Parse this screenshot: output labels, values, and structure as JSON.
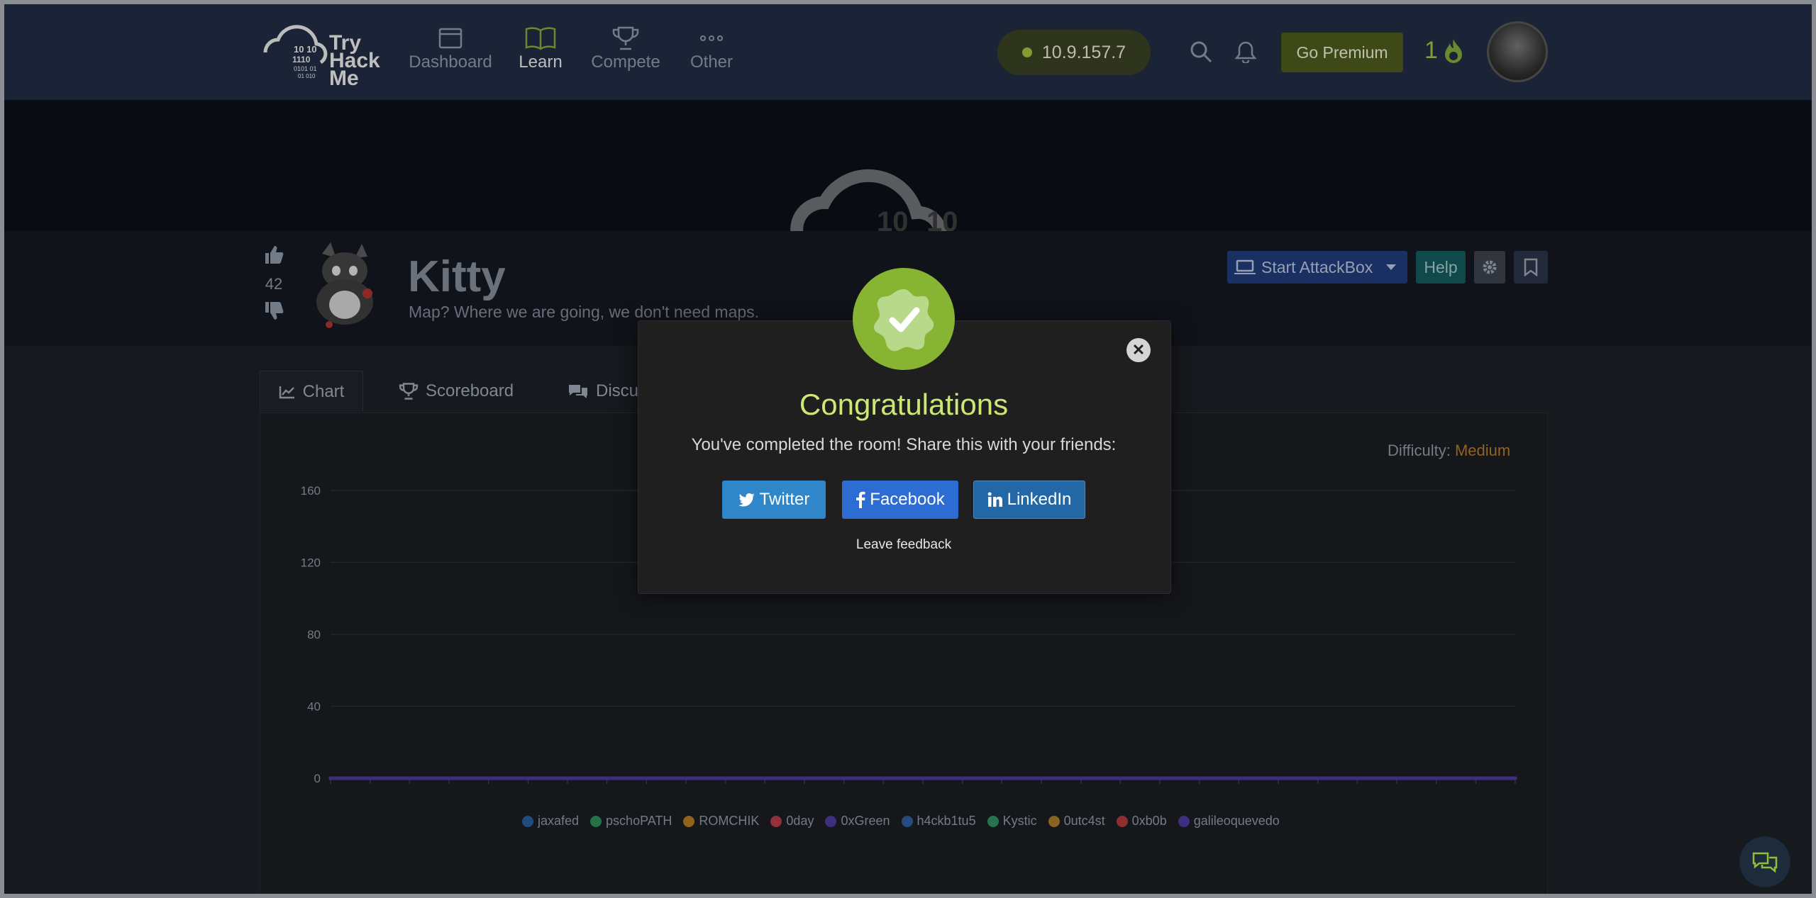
{
  "nav": {
    "logo_text": [
      "Try",
      "Hack",
      "Me"
    ],
    "items": [
      {
        "label": "Dashboard",
        "icon": "browser-window-icon",
        "active": false
      },
      {
        "label": "Learn",
        "icon": "book-open-icon",
        "active": true
      },
      {
        "label": "Compete",
        "icon": "trophy-icon",
        "active": false
      },
      {
        "label": "Other",
        "icon": "dots-icon",
        "active": false
      }
    ],
    "ip": "10.9.157.7",
    "premium_label": "Go Premium",
    "streak": "1"
  },
  "room": {
    "votes": "42",
    "title": "Kitty",
    "subtitle": "Map? Where we are going, we don't need maps.",
    "start_attackbox": "Start AttackBox",
    "help": "Help"
  },
  "tabs": [
    {
      "label": "Chart",
      "icon": "line-chart-icon"
    },
    {
      "label": "Scoreboard",
      "icon": "trophy-icon"
    },
    {
      "label": "Discu",
      "icon": "comments-icon"
    }
  ],
  "difficulty": {
    "label": "Difficulty:",
    "value": "Medium",
    "color": "#b1792a"
  },
  "chart_data": {
    "type": "line",
    "title": "",
    "xlabel": "",
    "ylabel": "",
    "ylim": [
      0,
      160
    ],
    "yticks": [
      0,
      40,
      80,
      120,
      160
    ],
    "x_points": 31,
    "series": [
      {
        "name": "jaxafed",
        "color": "#2b5c99",
        "values": [
          0,
          0,
          0,
          0,
          0,
          0,
          0,
          0,
          0,
          0,
          0,
          0,
          0,
          0,
          0,
          0,
          0,
          0,
          0,
          0,
          0,
          0,
          0,
          0,
          0,
          0,
          0,
          0,
          0,
          0,
          0
        ]
      },
      {
        "name": "pschoPATH",
        "color": "#2e8b57",
        "values": [
          0,
          0,
          0,
          0,
          0,
          0,
          0,
          0,
          0,
          0,
          0,
          0,
          0,
          0,
          0,
          0,
          0,
          0,
          0,
          0,
          0,
          0,
          0,
          0,
          0,
          0,
          0,
          0,
          0,
          0,
          0
        ]
      },
      {
        "name": "ROMCHIK",
        "color": "#b07a22",
        "values": [
          0,
          0,
          0,
          0,
          0,
          0,
          0,
          0,
          0,
          0,
          0,
          0,
          0,
          0,
          0,
          0,
          0,
          0,
          0,
          0,
          0,
          0,
          0,
          0,
          0,
          0,
          0,
          0,
          0,
          0,
          0
        ]
      },
      {
        "name": "0day",
        "color": "#b53a4a",
        "values": [
          0,
          0,
          0,
          0,
          0,
          0,
          0,
          0,
          0,
          0,
          0,
          0,
          0,
          0,
          0,
          0,
          0,
          0,
          0,
          0,
          0,
          0,
          0,
          0,
          0,
          0,
          0,
          0,
          0,
          0,
          0
        ]
      },
      {
        "name": "0xGreen",
        "color": "#4a3a9a",
        "values": [
          0,
          0,
          0,
          0,
          0,
          0,
          0,
          0,
          0,
          0,
          0,
          0,
          0,
          0,
          0,
          0,
          0,
          0,
          0,
          0,
          0,
          0,
          0,
          0,
          0,
          0,
          0,
          0,
          0,
          0,
          0
        ]
      },
      {
        "name": "h4ckb1tu5",
        "color": "#2c5d9e",
        "values": [
          0,
          0,
          0,
          0,
          0,
          0,
          0,
          0,
          0,
          0,
          0,
          0,
          0,
          0,
          0,
          0,
          0,
          0,
          0,
          0,
          0,
          0,
          0,
          0,
          0,
          0,
          0,
          0,
          0,
          0,
          0
        ]
      },
      {
        "name": "Kystic",
        "color": "#2f8f62",
        "values": [
          0,
          0,
          0,
          0,
          0,
          0,
          0,
          0,
          0,
          0,
          0,
          0,
          0,
          0,
          0,
          0,
          0,
          0,
          0,
          0,
          0,
          0,
          0,
          0,
          0,
          0,
          0,
          0,
          0,
          0,
          0
        ]
      },
      {
        "name": "0utc4st",
        "color": "#a9782a",
        "values": [
          0,
          0,
          0,
          0,
          0,
          0,
          0,
          0,
          0,
          0,
          0,
          0,
          0,
          0,
          0,
          0,
          0,
          0,
          0,
          0,
          0,
          0,
          0,
          0,
          0,
          0,
          0,
          0,
          0,
          0,
          0
        ]
      },
      {
        "name": "0xb0b",
        "color": "#b03a3a",
        "values": [
          0,
          0,
          0,
          0,
          0,
          0,
          0,
          0,
          0,
          0,
          0,
          0,
          0,
          0,
          0,
          0,
          0,
          0,
          0,
          0,
          0,
          0,
          0,
          0,
          0,
          0,
          0,
          0,
          0,
          0,
          0
        ]
      },
      {
        "name": "galileoquevedo",
        "color": "#4b3a9c",
        "values": [
          0,
          0,
          0,
          0,
          0,
          0,
          0,
          0,
          0,
          0,
          0,
          0,
          0,
          0,
          0,
          0,
          0,
          0,
          0,
          0,
          0,
          0,
          0,
          0,
          0,
          0,
          0,
          0,
          0,
          0,
          0
        ]
      }
    ]
  },
  "modal": {
    "title": "Congratulations",
    "message": "You've completed the room! Share this with your friends:",
    "twitter": "Twitter",
    "facebook": "Facebook",
    "linkedin": "LinkedIn",
    "feedback": "Leave feedback"
  }
}
